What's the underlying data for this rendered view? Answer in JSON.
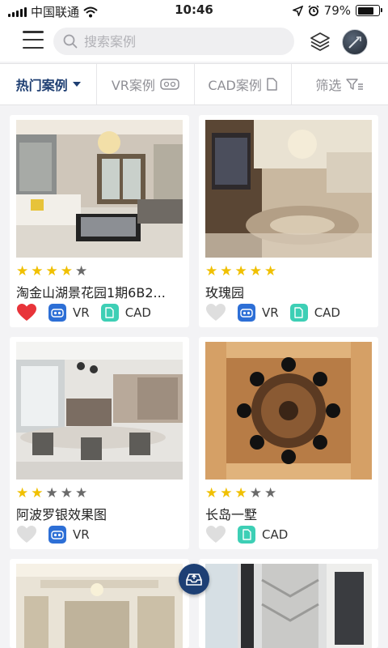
{
  "status_bar": {
    "carrier": "中国联通",
    "time": "10:46",
    "battery": "79%",
    "battery_level": 0.79
  },
  "header": {
    "search_placeholder": "搜索案例"
  },
  "tabs": [
    {
      "label": "热门案例",
      "active": true
    },
    {
      "label": "VR案例",
      "active": false
    },
    {
      "label": "CAD案例",
      "active": false
    },
    {
      "label": "筛选",
      "active": false
    }
  ],
  "cards": [
    {
      "title": "淘金山湖景花园1期6B2...",
      "rating": 4,
      "liked": true,
      "vr": "VR",
      "cad": "CAD"
    },
    {
      "title": "玫瑰园",
      "rating": 5,
      "liked": false,
      "vr": "VR",
      "cad": "CAD"
    },
    {
      "title": "阿波罗银效果图",
      "rating": 2,
      "liked": false,
      "vr": "VR",
      "cad": null
    },
    {
      "title": "长岛一墅",
      "rating": 3,
      "liked": false,
      "vr": null,
      "cad": "CAD"
    }
  ],
  "colors": {
    "accent": "#1e3e72",
    "star": "#f0c000",
    "heart_active": "#e8343a",
    "vr_badge": "#2d6fd6",
    "cad_badge": "#3dcfb5"
  },
  "icons": {
    "menu": "hamburger-menu-icon",
    "search": "search-icon",
    "layers": "layers-icon",
    "vr": "vr-headset-icon",
    "cad": "document-icon",
    "filter": "filter-icon",
    "fab": "inbox-upload-icon"
  }
}
